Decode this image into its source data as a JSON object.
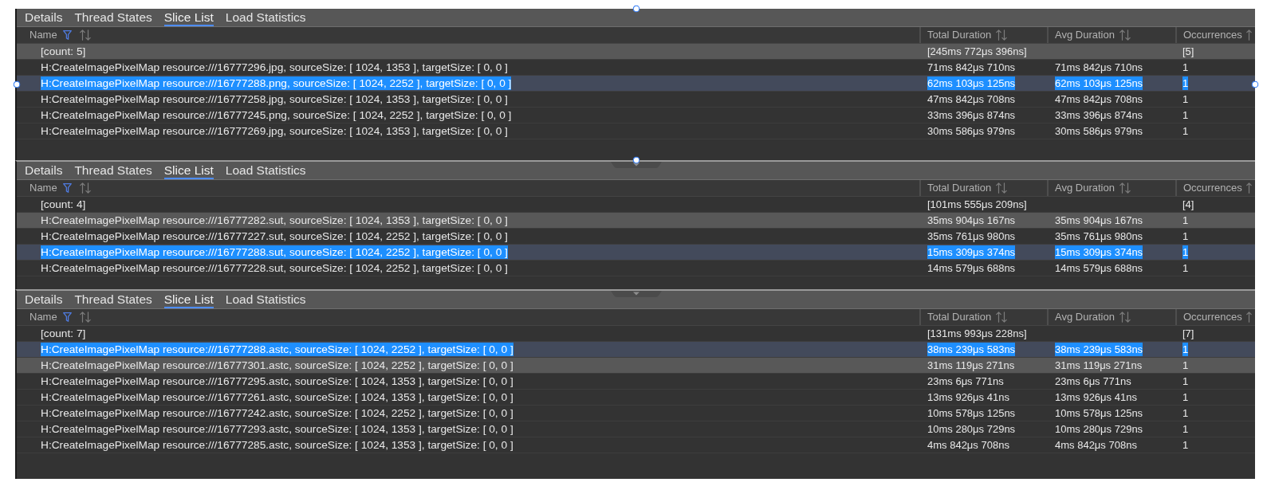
{
  "panels": [
    {
      "selected": true,
      "tabs": [
        {
          "label": "Details",
          "selected": false
        },
        {
          "label": "Thread States",
          "selected": false
        },
        {
          "label": "Slice List",
          "selected": true
        },
        {
          "label": "Load Statistics",
          "selected": false
        }
      ],
      "columns": [
        {
          "label": "Name",
          "filter": true,
          "sortable": true
        },
        {
          "label": "Total Duration",
          "sortable": true
        },
        {
          "label": "Avg Duration",
          "sortable": true
        },
        {
          "label": "Occurrences",
          "sortable": true
        }
      ],
      "rows": [
        {
          "name": "[count: 5]",
          "total_duration": "[245ms 772μs 396ns]",
          "occurrences": "[5]",
          "selected": false,
          "hovered": true
        },
        {
          "name": "H:CreateImagePixelMap resource:///16777296.jpg, sourceSize: [ 1024, 1353 ], targetSize: [ 0, 0 ]",
          "total_duration": "71ms 842μs 710ns",
          "avg_duration": "71ms 842μs 710ns",
          "occurrences": "1",
          "selected": false,
          "hovered": false
        },
        {
          "name": "H:CreateImagePixelMap resource:///16777288.png, sourceSize: [ 1024, 2252 ], targetSize: [ 0, 0 ]",
          "total_duration": "62ms 103μs 125ns",
          "avg_duration": "62ms 103μs 125ns",
          "occurrences": "1",
          "selected": true,
          "hovered": false
        },
        {
          "name": "H:CreateImagePixelMap resource:///16777258.jpg, sourceSize: [ 1024, 1353 ], targetSize: [ 0, 0 ]",
          "total_duration": "47ms 842μs 708ns",
          "avg_duration": "47ms 842μs 708ns",
          "occurrences": "1",
          "selected": false,
          "hovered": false
        },
        {
          "name": "H:CreateImagePixelMap resource:///16777245.png, sourceSize: [ 1024, 2252 ], targetSize: [ 0, 0 ]",
          "total_duration": "33ms 396μs 874ns",
          "avg_duration": "33ms 396μs 874ns",
          "occurrences": "1",
          "selected": false,
          "hovered": false
        },
        {
          "name": "H:CreateImagePixelMap resource:///16777269.jpg, sourceSize: [ 1024, 1353 ], targetSize: [ 0, 0 ]",
          "total_duration": "30ms 586μs 979ns",
          "avg_duration": "30ms 586μs 979ns",
          "occurrences": "1",
          "selected": false,
          "hovered": false
        }
      ]
    },
    {
      "selected": false,
      "tabs": [
        {
          "label": "Details",
          "selected": false
        },
        {
          "label": "Thread States",
          "selected": false
        },
        {
          "label": "Slice List",
          "selected": true
        },
        {
          "label": "Load Statistics",
          "selected": false
        }
      ],
      "columns": [
        {
          "label": "Name",
          "filter": true,
          "sortable": true
        },
        {
          "label": "Total Duration",
          "sortable": true
        },
        {
          "label": "Avg Duration",
          "sortable": true
        },
        {
          "label": "Occurrences",
          "sortable": true
        }
      ],
      "rows": [
        {
          "name": "[count: 4]",
          "total_duration": "[101ms 555μs 209ns]",
          "occurrences": "[4]",
          "selected": false,
          "hovered": false
        },
        {
          "name": "H:CreateImagePixelMap resource:///16777282.sut, sourceSize: [ 1024, 1353 ], targetSize: [ 0, 0 ]",
          "total_duration": "35ms 904μs 167ns",
          "avg_duration": "35ms 904μs 167ns",
          "occurrences": "1",
          "selected": false,
          "hovered": true
        },
        {
          "name": "H:CreateImagePixelMap resource:///16777227.sut, sourceSize: [ 1024, 2252 ], targetSize: [ 0, 0 ]",
          "total_duration": "35ms 761μs 980ns",
          "avg_duration": "35ms 761μs 980ns",
          "occurrences": "1",
          "selected": false,
          "hovered": false
        },
        {
          "name": "H:CreateImagePixelMap resource:///16777288.sut, sourceSize: [ 1024, 2252 ], targetSize: [ 0, 0 ]",
          "total_duration": "15ms 309μs 374ns",
          "avg_duration": "15ms 309μs 374ns",
          "occurrences": "1",
          "selected": true,
          "hovered": false
        },
        {
          "name": "H:CreateImagePixelMap resource:///16777228.sut, sourceSize: [ 1024, 2252 ], targetSize: [ 0, 0 ]",
          "total_duration": "14ms 579μs 688ns",
          "avg_duration": "14ms 579μs 688ns",
          "occurrences": "1",
          "selected": false,
          "hovered": false
        }
      ]
    },
    {
      "selected": false,
      "tabs": [
        {
          "label": "Details",
          "selected": false
        },
        {
          "label": "Thread States",
          "selected": false
        },
        {
          "label": "Slice List",
          "selected": true
        },
        {
          "label": "Load Statistics",
          "selected": false
        }
      ],
      "columns": [
        {
          "label": "Name",
          "filter": true,
          "sortable": true
        },
        {
          "label": "Total Duration",
          "sortable": true
        },
        {
          "label": "Avg Duration",
          "sortable": true
        },
        {
          "label": "Occurrences",
          "sortable": true
        }
      ],
      "rows": [
        {
          "name": "[count: 7]",
          "total_duration": "[131ms 993μs 228ns]",
          "occurrences": "[7]",
          "selected": false,
          "hovered": false
        },
        {
          "name": "H:CreateImagePixelMap resource:///16777288.astc, sourceSize: [ 1024, 2252 ], targetSize: [ 0, 0 ]",
          "total_duration": "38ms 239μs 583ns",
          "avg_duration": "38ms 239μs 583ns",
          "occurrences": "1",
          "selected": true,
          "hovered": false
        },
        {
          "name": "H:CreateImagePixelMap resource:///16777301.astc, sourceSize: [ 1024, 2252 ], targetSize: [ 0, 0 ]",
          "total_duration": "31ms 119μs 271ns",
          "avg_duration": "31ms 119μs 271ns",
          "occurrences": "1",
          "selected": false,
          "hovered": true
        },
        {
          "name": "H:CreateImagePixelMap resource:///16777295.astc, sourceSize: [ 1024, 1353 ], targetSize: [ 0, 0 ]",
          "total_duration": "23ms 6μs 771ns",
          "avg_duration": "23ms 6μs 771ns",
          "occurrences": "1",
          "selected": false,
          "hovered": false
        },
        {
          "name": "H:CreateImagePixelMap resource:///16777261.astc, sourceSize: [ 1024, 1353 ], targetSize: [ 0, 0 ]",
          "total_duration": "13ms 926μs 41ns",
          "avg_duration": "13ms 926μs 41ns",
          "occurrences": "1",
          "selected": false,
          "hovered": false
        },
        {
          "name": "H:CreateImagePixelMap resource:///16777242.astc, sourceSize: [ 1024, 2252 ], targetSize: [ 0, 0 ]",
          "total_duration": "10ms 578μs 125ns",
          "avg_duration": "10ms 578μs 125ns",
          "occurrences": "1",
          "selected": false,
          "hovered": false
        },
        {
          "name": "H:CreateImagePixelMap resource:///16777293.astc, sourceSize: [ 1024, 1353 ], targetSize: [ 0, 0 ]",
          "total_duration": "10ms 280μs 729ns",
          "avg_duration": "10ms 280μs 729ns",
          "occurrences": "1",
          "selected": false,
          "hovered": false
        },
        {
          "name": "H:CreateImagePixelMap resource:///16777285.astc, sourceSize: [ 1024, 1353 ], targetSize: [ 0, 0 ]",
          "total_duration": "4ms 842μs 708ns",
          "avg_duration": "4ms 842μs 708ns",
          "occurrences": "1",
          "selected": false,
          "hovered": false
        }
      ]
    }
  ]
}
